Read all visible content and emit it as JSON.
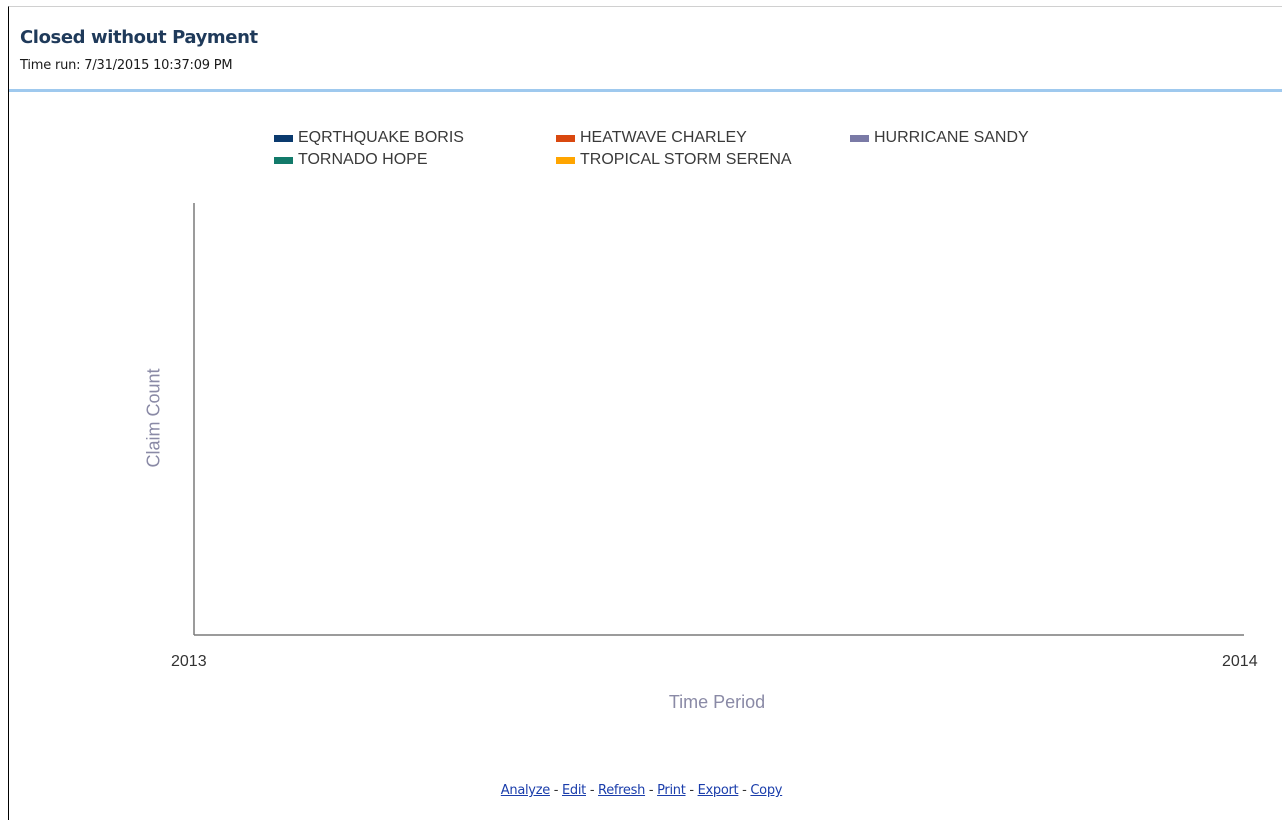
{
  "header": {
    "title": "Closed without Payment",
    "time_run": "Time run: 7/31/2015 10:37:09 PM"
  },
  "chart_data": {
    "type": "line",
    "title": "",
    "xlabel": "Time Period",
    "ylabel": "Claim Count",
    "x_ticks": [
      "2013",
      "2014"
    ],
    "legend_position": "top",
    "grid": false,
    "series": [
      {
        "name": "EQRTHQUAKE BORIS",
        "color": "#0a3a6e",
        "values": []
      },
      {
        "name": "HEATWAVE CHARLEY",
        "color": "#d9480f",
        "values": []
      },
      {
        "name": "HURRICANE SANDY",
        "color": "#7a7aa6",
        "values": []
      },
      {
        "name": "TORNADO HOPE",
        "color": "#127a6a",
        "values": []
      },
      {
        "name": "TROPICAL STORM SERENA",
        "color": "#ffa500",
        "values": []
      }
    ]
  },
  "footer": {
    "links": [
      {
        "label": "Analyze",
        "name": "analyze-link"
      },
      {
        "label": "Edit",
        "name": "edit-link"
      },
      {
        "label": "Refresh",
        "name": "refresh-link"
      },
      {
        "label": "Print",
        "name": "print-link"
      },
      {
        "label": "Export",
        "name": "export-link"
      },
      {
        "label": "Copy",
        "name": "copy-link"
      }
    ],
    "separator": " - "
  }
}
